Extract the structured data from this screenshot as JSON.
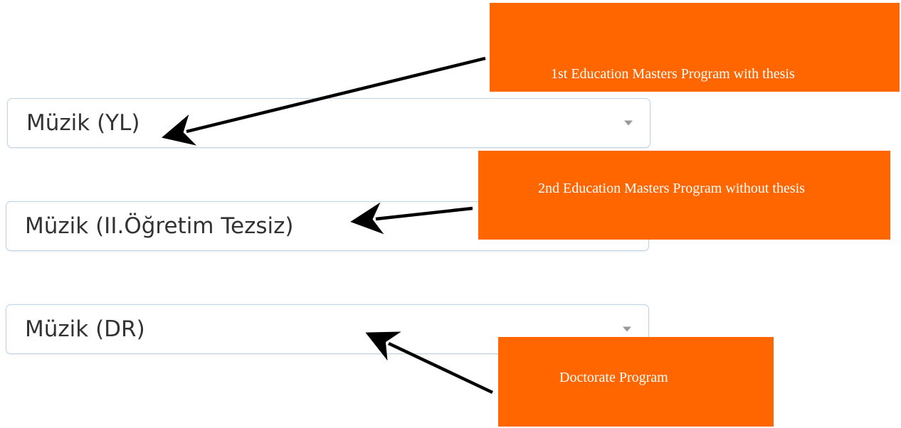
{
  "dropdowns": [
    {
      "value": "Müzik (YL)",
      "icon": "chevron-down-icon"
    },
    {
      "value": "Müzik (II.Öğretim Tezsiz)",
      "icon": "chevron-down-icon"
    },
    {
      "value": "Müzik (DR)",
      "icon": "chevron-down-icon"
    }
  ],
  "annotations": [
    {
      "text": "1st Education Masters Program with thesis"
    },
    {
      "text": "2nd Education Masters Program without thesis"
    },
    {
      "text": "Doctorate Program"
    }
  ],
  "colors": {
    "callout_background": "#ff6600",
    "callout_text": "#ffffff",
    "select_border": "#bcd3e8",
    "arrow": "#000000"
  }
}
